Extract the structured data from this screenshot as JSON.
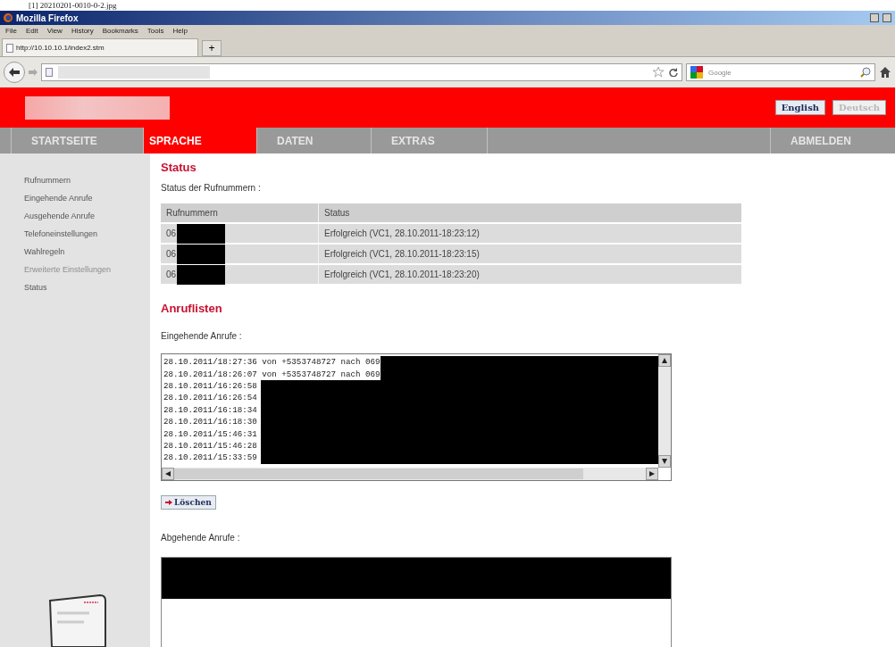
{
  "caption": "[1] 20210201-0010-0-2.jpg",
  "window": {
    "title": "Mozilla Firefox"
  },
  "menu": [
    "File",
    "Edit",
    "View",
    "History",
    "Bookmarks",
    "Tools",
    "Help"
  ],
  "browser_tab": {
    "title": "http://10.10.10.1/index2.stm"
  },
  "new_tab_button": "+",
  "search": {
    "placeholder": "Google"
  },
  "languages": [
    {
      "label": "English",
      "selected": true
    },
    {
      "label": "Deutsch",
      "selected": false
    }
  ],
  "nav": [
    {
      "label": "STARTSEITE",
      "selected": false
    },
    {
      "label": "SPRACHE",
      "selected": true
    },
    {
      "label": "DATEN",
      "selected": false
    },
    {
      "label": "EXTRAS",
      "selected": false
    },
    {
      "label": "ABMELDEN",
      "selected": false
    }
  ],
  "sidebar": {
    "items": [
      {
        "label": "Rufnummern",
        "disabled": false
      },
      {
        "label": "Eingehende Anrufe",
        "disabled": false
      },
      {
        "label": "Ausgehende Anrufe",
        "disabled": false
      },
      {
        "label": "Telefoneinstellungen",
        "disabled": false
      },
      {
        "label": "Wahlregeln",
        "disabled": false
      },
      {
        "label": "Erweiterte Einstellungen",
        "disabled": true
      },
      {
        "label": "Status",
        "disabled": false
      }
    ]
  },
  "status_section": {
    "heading": "Status",
    "subtitle": "Status der Rufnummern :",
    "table": {
      "columns": [
        "Rufnummern",
        "Status"
      ],
      "rows": [
        [
          "06",
          "Erfolgreich (VC1, 28.10.2011-18:23:12)"
        ],
        [
          "06",
          "Erfolgreich (VC1, 28.10.2011-18:23:15)"
        ],
        [
          "06",
          "Erfolgreich (VC1, 28.10.2011-18:23:20)"
        ]
      ]
    }
  },
  "call_lists": {
    "heading": "Anruflisten",
    "incoming": {
      "label": "Eingehende Anrufe :",
      "lines": [
        "28.10.2011/18:27:36 von +5353748727 nach 069",
        "28.10.2011/18:26:07 von +5353748727 nach 069",
        "28.10.2011/16:26:58",
        "28.10.2011/16:26:54",
        "28.10.2011/16:18:34",
        "28.10.2011/16:18:30",
        "28.10.2011/15:46:31",
        "28.10.2011/15:46:28",
        "28.10.2011/15:33:59"
      ]
    },
    "delete_button": "Löschen",
    "outgoing": {
      "label": "Abgehende Anrufe :"
    }
  }
}
